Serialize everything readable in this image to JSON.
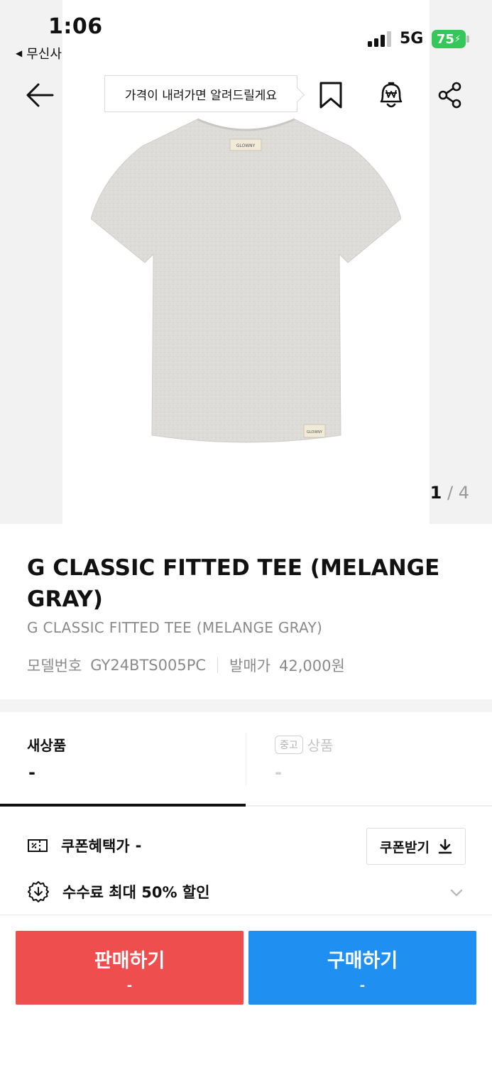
{
  "status_bar": {
    "time": "1:06",
    "back_app": "무신사",
    "network": "5G",
    "battery": "75"
  },
  "top_nav": {
    "tooltip": "가격이 내려가면 알려드릴게요"
  },
  "gallery": {
    "current_page": "1",
    "separator": "/",
    "total_pages": "4",
    "tee_label": "GLOWNY"
  },
  "product": {
    "title": "G CLASSIC FITTED TEE (MELANGE GRAY)",
    "subtitle": "G CLASSIC FITTED TEE (MELANGE GRAY)",
    "model_label": "모델번호",
    "model_value": "GY24BTS005PC",
    "release_price_label": "발매가",
    "release_price_value": "42,000원"
  },
  "tabs": {
    "new": {
      "label": "새상품",
      "price": "-"
    },
    "used": {
      "chip": "중고",
      "label": "상품",
      "price": "-"
    }
  },
  "coupon": {
    "label": "쿠폰혜택가",
    "value": "-",
    "button_label": "쿠폰받기"
  },
  "fee": {
    "label": "수수료 최대 50% 할인"
  },
  "actions": {
    "sell_label": "판매하기",
    "sell_price": "-",
    "buy_label": "구매하기",
    "buy_price": "-"
  },
  "colors": {
    "sell": "#ef4e4e",
    "buy": "#1f8ff2",
    "battery": "#34c759"
  }
}
